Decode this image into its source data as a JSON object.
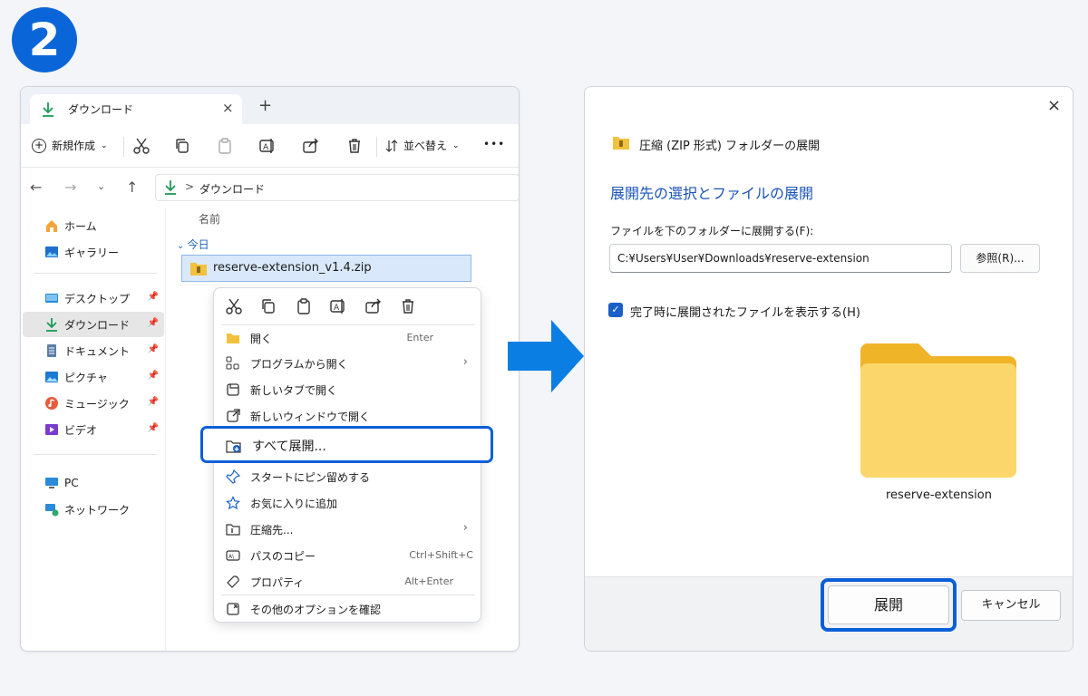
{
  "step": "2",
  "explorer": {
    "tab_label": "ダウンロード",
    "tab_close": "×",
    "tab_new": "+",
    "toolbar": {
      "new_label": "新規作成",
      "sort_label": "並べ替え",
      "more": "•••"
    },
    "address": {
      "text": "ダウンロード",
      "separator": ">"
    },
    "sidebar": [
      {
        "label": "ホーム",
        "icon": "home-icon"
      },
      {
        "label": "ギャラリー",
        "icon": "gallery-icon"
      },
      {
        "label": "デスクトップ",
        "icon": "desktop-icon",
        "pinned": true
      },
      {
        "label": "ダウンロード",
        "icon": "download-icon",
        "pinned": true,
        "active": true
      },
      {
        "label": "ドキュメント",
        "icon": "documents-icon",
        "pinned": true
      },
      {
        "label": "ピクチャ",
        "icon": "pictures-icon",
        "pinned": true
      },
      {
        "label": "ミュージック",
        "icon": "music-icon",
        "pinned": true
      },
      {
        "label": "ビデオ",
        "icon": "video-icon",
        "pinned": true
      },
      {
        "label": "PC",
        "icon": "pc-icon"
      },
      {
        "label": "ネットワーク",
        "icon": "network-icon"
      }
    ],
    "column_header": "名前",
    "group_label": "今日",
    "file_name": "reserve-extension_v1.4.zip"
  },
  "context_menu": {
    "items": [
      {
        "label": "開く",
        "shortcut": "Enter",
        "icon": "open-folder-icon"
      },
      {
        "label": "プログラムから開く",
        "submenu": true,
        "icon": "open-with-icon"
      },
      {
        "label": "新しいタブで開く",
        "icon": "new-tab-icon"
      },
      {
        "label": "新しいウィンドウで開く",
        "icon": "new-window-icon"
      },
      {
        "label": "すべて展開...",
        "icon": "extract-all-icon",
        "highlighted": true
      },
      {
        "label": "スタートにピン留めする",
        "icon": "pin-icon"
      },
      {
        "label": "お気に入りに追加",
        "icon": "star-icon"
      },
      {
        "label": "圧縮先...",
        "submenu": true,
        "icon": "compress-icon"
      },
      {
        "label": "パスのコピー",
        "shortcut": "Ctrl+Shift+C",
        "icon": "copy-path-icon"
      },
      {
        "label": "プロパティ",
        "shortcut": "Alt+Enter",
        "icon": "wrench-icon"
      },
      {
        "label": "その他のオプションを確認",
        "icon": "more-options-icon"
      }
    ]
  },
  "dialog": {
    "title": "圧縮 (ZIP 形式) フォルダーの展開",
    "heading": "展開先の選択とファイルの展開",
    "path_label": "ファイルを下のフォルダーに展開する(F):",
    "path_value": "C:¥Users¥User¥Downloads¥reserve-extension",
    "browse_label": "参照(R)...",
    "checkbox_label": "完了時に展開されたファイルを表示する(H)",
    "checkbox_checked": true,
    "folder_name": "reserve-extension",
    "extract_label": "展開",
    "cancel_label": "キャンセル",
    "close": "×"
  },
  "colors": {
    "accent": "#0a5fd8",
    "heading": "#1a54b8",
    "folder": "#f6c343"
  }
}
